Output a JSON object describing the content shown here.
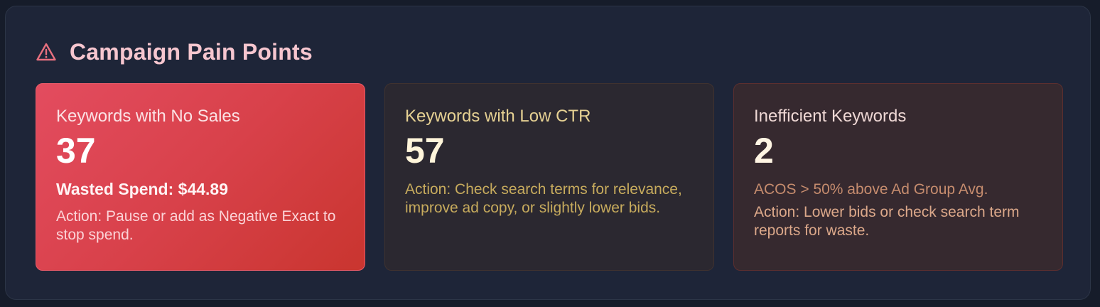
{
  "header": {
    "icon": "warning-triangle-icon",
    "title": "Campaign Pain Points"
  },
  "cards": [
    {
      "label": "Keywords with No Sales",
      "value": "37",
      "wasted_spend": "Wasted Spend: $44.89",
      "action": "Action: Pause or add as Negative Exact to stop spend."
    },
    {
      "label": "Keywords with Low CTR",
      "value": "57",
      "action": "Action: Check search terms for relevance, improve ad copy, or slightly lower bids."
    },
    {
      "label": "Inefficient Keywords",
      "value": "2",
      "note": "ACOS > 50% above Ad Group Avg.",
      "action": "Action: Lower bids or check search term reports for waste."
    }
  ],
  "colors": {
    "title": "#f6c6cf",
    "warning_icon": "#e8707f",
    "panel_bg": "#1e2538",
    "card_red": "#d8414a",
    "card_yellow_bg": "#2b2830",
    "card_brown_bg": "#36292f"
  }
}
